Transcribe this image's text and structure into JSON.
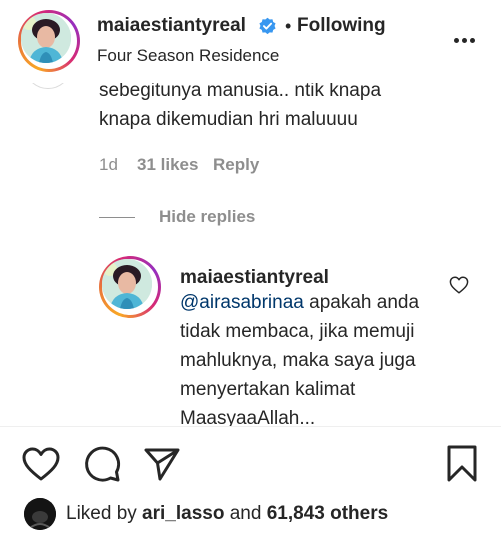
{
  "header": {
    "username": "maiaestiantyreal",
    "separator": "•",
    "follow_status": "Following",
    "location": "Four Season Residence",
    "more_icon": "more-horizontal-icon",
    "verified_icon": "verified-badge-icon",
    "verified_color": "#3897f0"
  },
  "comments": {
    "first": {
      "text": "sebegitunya manusia.. ntik knapa knapa dikemudian hri maluuuu",
      "time": "1d",
      "likes": "31 likes",
      "reply_label": "Reply"
    },
    "hide_replies_label": "Hide replies",
    "reply": {
      "username": "maiaestiantyreal",
      "mention": "@airasabrinaa",
      "text": " apakah anda tidak membaca, jika memuji mahluknya, maka saya juga menyertakan kalimat MaasyaaAllah...",
      "like_icon": "heart-outline-icon"
    }
  },
  "actions": {
    "like_icon": "heart-icon",
    "comment_icon": "comment-bubble-icon",
    "share_icon": "paper-plane-icon",
    "save_icon": "bookmark-icon"
  },
  "likes": {
    "prefix": "Liked by ",
    "user": "ari_lasso",
    "middle": " and ",
    "count": "61,843 others"
  },
  "colors": {
    "text": "#262626",
    "secondary": "#8e8e8e",
    "mention": "#00376b",
    "divider": "#efefef"
  }
}
